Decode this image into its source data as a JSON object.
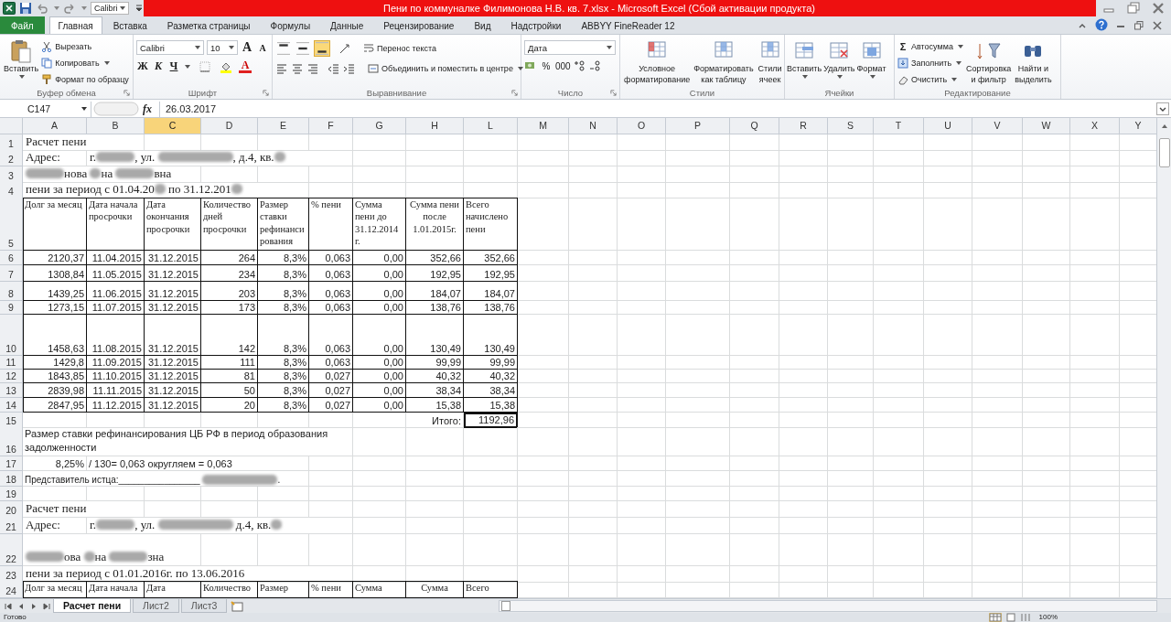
{
  "title_bar": {
    "font_box": "Calibri",
    "title": "Пени  по коммуналке Филимонова Н.В. кв. 7.xlsx  -  Microsoft Excel (Сбой активации продукта)"
  },
  "tabs": [
    {
      "label": "Файл",
      "kind": "file",
      "selected": false
    },
    {
      "label": "Главная",
      "kind": "tab",
      "selected": true
    },
    {
      "label": "Вставка",
      "kind": "tab",
      "selected": false
    },
    {
      "label": "Разметка страницы",
      "kind": "tab",
      "selected": false
    },
    {
      "label": "Формулы",
      "kind": "tab",
      "selected": false
    },
    {
      "label": "Данные",
      "kind": "tab",
      "selected": false
    },
    {
      "label": "Рецензирование",
      "kind": "tab",
      "selected": false
    },
    {
      "label": "Вид",
      "kind": "tab",
      "selected": false
    },
    {
      "label": "Надстройки",
      "kind": "tab",
      "selected": false
    },
    {
      "label": "ABBYY FineReader 12",
      "kind": "tab",
      "selected": false
    }
  ],
  "ribbon": {
    "clipboard": {
      "label": "Буфер обмена",
      "paste": "Вставить",
      "cut": "Вырезать",
      "copy": "Копировать",
      "format_painter": "Формат по образцу"
    },
    "font": {
      "label": "Шрифт",
      "name": "Calibri",
      "size": "10",
      "grow": "A",
      "shrink": "A",
      "bold": "Ж",
      "italic": "К",
      "underline": "Ч",
      "font_color_glyph": "А"
    },
    "alignment": {
      "label": "Выравнивание",
      "wrap": "Перенос текста",
      "merge": "Объединить и поместить в центре",
      "vertical": [
        {
          "selected": false
        },
        {
          "selected": false
        },
        {
          "selected": true
        }
      ]
    },
    "number": {
      "label": "Число",
      "format": "Дата",
      "percent": "%",
      "thousands": "000"
    },
    "styles": {
      "label": "Стили",
      "buttons": [
        {
          "lines": [
            "Условное",
            "форматирование"
          ]
        },
        {
          "lines": [
            "Форматировать",
            "как таблицу"
          ]
        },
        {
          "lines": [
            "Стили",
            "ячеек"
          ]
        }
      ]
    },
    "cells": {
      "label": "Ячейки",
      "buttons": [
        "Вставить",
        "Удалить",
        "Формат"
      ]
    },
    "editing": {
      "label": "Редактирование",
      "autosum_symbol": "Σ",
      "autosum": "Автосумма",
      "fill": "Заполнить",
      "clear": "Очистить",
      "sort": [
        "Сортировка",
        "и фильтр"
      ],
      "find": [
        "Найти и",
        "выделить"
      ]
    }
  },
  "formula_bar": {
    "name_box": "C147",
    "fx_symbol": "fx",
    "value": "26.03.2017"
  },
  "sheet": {
    "columns": [
      {
        "label": "A",
        "selected": false
      },
      {
        "label": "B",
        "selected": false
      },
      {
        "label": "C",
        "selected": true
      },
      {
        "label": "D",
        "selected": false
      },
      {
        "label": "E",
        "selected": false
      },
      {
        "label": "F",
        "selected": false
      },
      {
        "label": "G",
        "selected": false
      },
      {
        "label": "H",
        "selected": false
      },
      {
        "label": "L",
        "selected": false
      },
      {
        "label": "M",
        "selected": false
      },
      {
        "label": "N",
        "selected": false
      },
      {
        "label": "O",
        "selected": false
      },
      {
        "label": "P",
        "selected": false
      },
      {
        "label": "Q",
        "selected": false
      },
      {
        "label": "R",
        "selected": false
      },
      {
        "label": "S",
        "selected": false
      },
      {
        "label": "T",
        "selected": false
      },
      {
        "label": "U",
        "selected": false
      },
      {
        "label": "V",
        "selected": false
      },
      {
        "label": "W",
        "selected": false
      },
      {
        "label": "X",
        "selected": false
      },
      {
        "label": "Y",
        "selected": false
      }
    ],
    "rows": [
      {
        "num": "1",
        "kind": "plain",
        "cells": [
          {
            "kind": "title",
            "text": "Расчет пени"
          }
        ]
      },
      {
        "num": "2",
        "kind": "plain",
        "cells": [
          {
            "kind": "title",
            "text": "Адрес:"
          },
          {
            "kind": "title",
            "segments": [
              {
                "kind": "text",
                "text": "г."
              },
              {
                "kind": "redacted_short"
              },
              {
                "kind": "text",
                "text": ", ул. "
              },
              {
                "kind": "redacted_long"
              },
              {
                "kind": "text",
                "text": ", д.4, кв."
              },
              {
                "kind": "redacted_tiny"
              }
            ]
          }
        ]
      },
      {
        "num": "3",
        "kind": "plain",
        "cells": [
          {
            "kind": "title",
            "segments": [
              {
                "kind": "redacted_short"
              },
              {
                "kind": "text",
                "text": "нова "
              },
              {
                "kind": "redacted_tiny"
              },
              {
                "kind": "text",
                "text": "на "
              },
              {
                "kind": "redacted_short"
              },
              {
                "kind": "text",
                "text": "вна"
              }
            ]
          }
        ]
      },
      {
        "num": "4",
        "kind": "plain",
        "cells": [
          {
            "kind": "title",
            "segments": [
              {
                "kind": "text",
                "text": "пени за период с 01.04.20"
              },
              {
                "kind": "redacted_tiny"
              },
              {
                "kind": "text",
                "text": " по 31.12.201"
              },
              {
                "kind": "redacted_tiny"
              }
            ]
          }
        ]
      },
      {
        "num": "5",
        "kind": "table",
        "cells": [
          {
            "kind": "header",
            "text": "Долг за месяц"
          },
          {
            "kind": "header",
            "text": "Дата начала просрочки"
          },
          {
            "kind": "header",
            "text": "Дата окончания просрочки"
          },
          {
            "kind": "header",
            "text": "Количество дней просрочки"
          },
          {
            "kind": "header",
            "text": "Размер ставки рефинансирования"
          },
          {
            "kind": "header",
            "text": "% пени"
          },
          {
            "kind": "header",
            "text": "Сумма пени до 31.12.2014 г."
          },
          {
            "kind": "header_center",
            "text": "Сумма пени после 1.01.2015г."
          },
          {
            "kind": "header",
            "text": "Всего начислено пени"
          }
        ]
      },
      {
        "num": "6",
        "kind": "table",
        "cells": [
          {
            "kind": "number",
            "text": "2120,37"
          },
          {
            "kind": "number",
            "text": "11.04.2015"
          },
          {
            "kind": "number",
            "text": "31.12.2015"
          },
          {
            "kind": "number",
            "text": "264"
          },
          {
            "kind": "number",
            "text": "8,3%"
          },
          {
            "kind": "number",
            "text": "0,063"
          },
          {
            "kind": "number",
            "text": "0,00"
          },
          {
            "kind": "number",
            "text": "352,66"
          },
          {
            "kind": "number",
            "text": "352,66"
          }
        ]
      },
      {
        "num": "7",
        "kind": "table",
        "cells": [
          {
            "kind": "number",
            "text": "1308,84"
          },
          {
            "kind": "number",
            "text": "11.05.2015"
          },
          {
            "kind": "number",
            "text": "31.12.2015"
          },
          {
            "kind": "number",
            "text": "234"
          },
          {
            "kind": "number",
            "text": "8,3%"
          },
          {
            "kind": "number",
            "text": "0,063"
          },
          {
            "kind": "number",
            "text": "0,00"
          },
          {
            "kind": "number",
            "text": "192,95"
          },
          {
            "kind": "number",
            "text": "192,95"
          }
        ]
      },
      {
        "num": "8",
        "kind": "table",
        "cells": [
          {
            "kind": "number",
            "text": "1439,25"
          },
          {
            "kind": "number",
            "text": "11.06.2015"
          },
          {
            "kind": "number",
            "text": "31.12.2015"
          },
          {
            "kind": "number",
            "text": "203"
          },
          {
            "kind": "number",
            "text": "8,3%"
          },
          {
            "kind": "number",
            "text": "0,063"
          },
          {
            "kind": "number",
            "text": "0,00"
          },
          {
            "kind": "number",
            "text": "184,07"
          },
          {
            "kind": "number",
            "text": "184,07"
          }
        ]
      },
      {
        "num": "9",
        "kind": "table",
        "cells": [
          {
            "kind": "number",
            "text": "1273,15"
          },
          {
            "kind": "number",
            "text": "11.07.2015"
          },
          {
            "kind": "number",
            "text": "31.12.2015"
          },
          {
            "kind": "number",
            "text": "173"
          },
          {
            "kind": "number",
            "text": "8,3%"
          },
          {
            "kind": "number",
            "text": "0,063"
          },
          {
            "kind": "number",
            "text": "0,00"
          },
          {
            "kind": "number",
            "text": "138,76"
          },
          {
            "kind": "number",
            "text": "138,76"
          }
        ]
      },
      {
        "num": "10",
        "kind": "table",
        "cells": [
          {
            "kind": "number",
            "text": "1458,63"
          },
          {
            "kind": "number",
            "text": "11.08.2015"
          },
          {
            "kind": "number",
            "text": "31.12.2015"
          },
          {
            "kind": "number",
            "text": "142"
          },
          {
            "kind": "number",
            "text": "8,3%"
          },
          {
            "kind": "number",
            "text": "0,063"
          },
          {
            "kind": "number",
            "text": "0,00"
          },
          {
            "kind": "number",
            "text": "130,49"
          },
          {
            "kind": "number",
            "text": "130,49"
          }
        ]
      },
      {
        "num": "11",
        "kind": "table",
        "cells": [
          {
            "kind": "number",
            "text": "1429,8"
          },
          {
            "kind": "number",
            "text": "11.09.2015"
          },
          {
            "kind": "number",
            "text": "31.12.2015"
          },
          {
            "kind": "number",
            "text": "111"
          },
          {
            "kind": "number",
            "text": "8,3%"
          },
          {
            "kind": "number",
            "text": "0,063"
          },
          {
            "kind": "number",
            "text": "0,00"
          },
          {
            "kind": "number",
            "text": "99,99"
          },
          {
            "kind": "number",
            "text": "99,99"
          }
        ]
      },
      {
        "num": "12",
        "kind": "table",
        "cells": [
          {
            "kind": "number",
            "text": "1843,85"
          },
          {
            "kind": "number",
            "text": "11.10.2015"
          },
          {
            "kind": "number",
            "text": "31.12.2015"
          },
          {
            "kind": "number",
            "text": "81"
          },
          {
            "kind": "number",
            "text": "8,3%"
          },
          {
            "kind": "number",
            "text": "0,027"
          },
          {
            "kind": "number",
            "text": "0,00"
          },
          {
            "kind": "number",
            "text": "40,32"
          },
          {
            "kind": "number",
            "text": "40,32"
          }
        ]
      },
      {
        "num": "13",
        "kind": "table",
        "cells": [
          {
            "kind": "number",
            "text": "2839,98"
          },
          {
            "kind": "number",
            "text": "11.11.2015"
          },
          {
            "kind": "number",
            "text": "31.12.2015"
          },
          {
            "kind": "number",
            "text": "50"
          },
          {
            "kind": "number",
            "text": "8,3%"
          },
          {
            "kind": "number",
            "text": "0,027"
          },
          {
            "kind": "number",
            "text": "0,00"
          },
          {
            "kind": "number",
            "text": "38,34"
          },
          {
            "kind": "number",
            "text": "38,34"
          }
        ]
      },
      {
        "num": "14",
        "kind": "table",
        "cells": [
          {
            "kind": "number",
            "text": "2847,95"
          },
          {
            "kind": "number",
            "text": "11.12.2015"
          },
          {
            "kind": "number",
            "text": "31.12.2015"
          },
          {
            "kind": "number",
            "text": "20"
          },
          {
            "kind": "number",
            "text": "8,3%"
          },
          {
            "kind": "number",
            "text": "0,027"
          },
          {
            "kind": "number",
            "text": "0,00"
          },
          {
            "kind": "number",
            "text": "15,38"
          },
          {
            "kind": "number",
            "text": "15,38"
          }
        ]
      },
      {
        "num": "15",
        "kind": "plain",
        "cells": [
          {
            "kind": "empty"
          },
          {
            "kind": "empty"
          },
          {
            "kind": "empty"
          },
          {
            "kind": "empty"
          },
          {
            "kind": "empty"
          },
          {
            "kind": "empty"
          },
          {
            "kind": "empty"
          },
          {
            "kind": "number",
            "text": "Итого:"
          },
          {
            "kind": "total",
            "text": "1192,96"
          }
        ]
      },
      {
        "num": "16",
        "kind": "plain",
        "cells": [
          {
            "kind": "note_wrap",
            "text": "Размер ставки рефинансирования ЦБ РФ в период образования задолженности"
          }
        ]
      },
      {
        "num": "17",
        "kind": "plain",
        "cells": [
          {
            "kind": "number",
            "text": "8,25%"
          },
          {
            "kind": "note",
            "text": "/ 130= 0,063 округляем = 0,063"
          }
        ]
      },
      {
        "num": "18",
        "kind": "plain",
        "cells": [
          {
            "kind": "note_small",
            "segments": [
              {
                "kind": "text",
                "text": "Представитель истца:________________ "
              },
              {
                "kind": "redacted_long"
              },
              {
                "kind": "text",
                "text": "."
              }
            ]
          }
        ]
      },
      {
        "num": "19",
        "kind": "plain",
        "cells": []
      },
      {
        "num": "20",
        "kind": "plain",
        "cells": [
          {
            "kind": "title",
            "text": "Расчет пени"
          }
        ]
      },
      {
        "num": "21",
        "kind": "plain",
        "cells": [
          {
            "kind": "title",
            "text": "Адрес:"
          },
          {
            "kind": "title",
            "segments": [
              {
                "kind": "text",
                "text": "г."
              },
              {
                "kind": "redacted_short"
              },
              {
                "kind": "text",
                "text": ", ул. "
              },
              {
                "kind": "redacted_long"
              },
              {
                "kind": "text",
                "text": " д.4, кв."
              },
              {
                "kind": "redacted_tiny"
              }
            ]
          }
        ]
      },
      {
        "num": "22",
        "kind": "plain",
        "cells": [
          {
            "kind": "title",
            "segments": [
              {
                "kind": "redacted_short"
              },
              {
                "kind": "text",
                "text": "ова "
              },
              {
                "kind": "redacted_tiny"
              },
              {
                "kind": "text",
                "text": "на "
              },
              {
                "kind": "redacted_short"
              },
              {
                "kind": "text",
                "text": "зна"
              }
            ]
          }
        ]
      },
      {
        "num": "23",
        "kind": "plain",
        "cells": [
          {
            "kind": "title",
            "text": "пени за период с 01.01.2016г. по 13.06.2016"
          }
        ]
      },
      {
        "num": "24",
        "kind": "table",
        "cells": [
          {
            "kind": "header",
            "text": "Долг за месяц"
          },
          {
            "kind": "header",
            "text": "Дата начала"
          },
          {
            "kind": "header",
            "text": "Дата"
          },
          {
            "kind": "header",
            "text": "Количество"
          },
          {
            "kind": "header",
            "text": "Размер"
          },
          {
            "kind": "header",
            "text": "% пени"
          },
          {
            "kind": "header",
            "text": "Сумма"
          },
          {
            "kind": "header_center",
            "text": "Сумма"
          },
          {
            "kind": "header",
            "text": "Всего"
          }
        ]
      }
    ]
  },
  "sheet_tabs": [
    {
      "label": "Расчет пени",
      "selected": true
    },
    {
      "label": "Лист2",
      "selected": false
    },
    {
      "label": "Лист3",
      "selected": false
    }
  ],
  "status_bar": {
    "text": "Готово",
    "zoom": "100%"
  }
}
